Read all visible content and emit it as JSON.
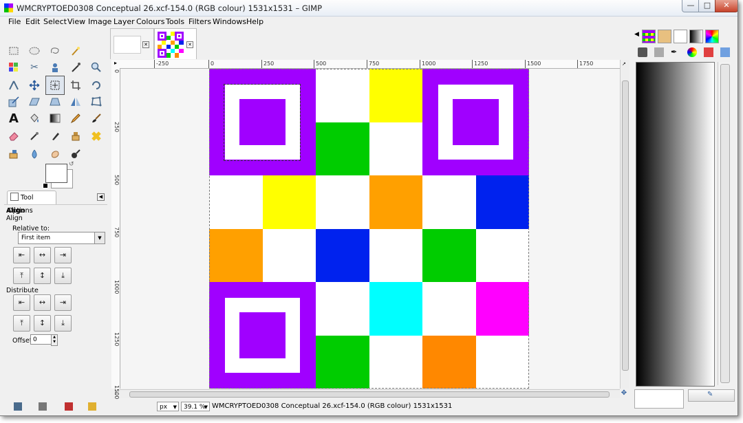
{
  "window": {
    "title": "WMCRYPTOED0308 Conceptual 26.xcf-154.0 (RGB colour) 1531x1531 – GIMP"
  },
  "menu": [
    "File",
    "Edit",
    "Select",
    "View",
    "Image",
    "Layer",
    "Colours",
    "Tools",
    "Filters",
    "Windows",
    "Help"
  ],
  "toolbox": {
    "tools": [
      "rect-select",
      "ellipse-select",
      "free-select",
      "fuzzy-select",
      "color-select",
      "scissors-select",
      "foreground-select",
      "color-picker",
      "zoom",
      "measure",
      "move",
      "align",
      "crop",
      "rotate",
      "scale",
      "shear",
      "perspective",
      "flip",
      "cage",
      "text",
      "bucket-fill",
      "blend",
      "pencil",
      "paintbrush",
      "eraser",
      "airbrush",
      "ink",
      "clone",
      "heal",
      "perspective-clone",
      "blur",
      "smudge",
      "dodge-burn"
    ]
  },
  "tool_options": {
    "tab_label": "Tool Options",
    "heading": "Align",
    "subheading": "Align",
    "relative_to_label": "Relative to:",
    "relative_to_value": "First item",
    "distribute_label": "Distribute",
    "offset_label": "Offset:",
    "offset_value": "0"
  },
  "ruler": {
    "h_ticks": [
      "-250",
      "0",
      "250",
      "500",
      "750",
      "1000",
      "1250",
      "1500",
      "1750"
    ],
    "v_ticks": [
      "0",
      "250",
      "500",
      "750",
      "1000",
      "1250",
      "1500"
    ]
  },
  "status": {
    "unit": "px",
    "zoom": "39.1 %",
    "text": "WMCRYPTOED0308 Conceptual 26.xcf-154.0 (RGB colour) 1531x1531"
  },
  "image": {
    "grid_size": 6,
    "colors": {
      "purple": "#a000ff",
      "white": "#ffffff",
      "yellow": "#ffff00",
      "green": "#00cc00",
      "orange": "#ffa000",
      "blue": "#0022ee",
      "cyan": "#00ffff",
      "magenta": "#ff00ff",
      "dark_orange": "#ff8800"
    },
    "cells": [
      {
        "row": 0,
        "col": 2,
        "color": "#ffffff"
      },
      {
        "row": 0,
        "col": 3,
        "color": "#ffff00"
      },
      {
        "row": 1,
        "col": 2,
        "color": "#00cc00"
      },
      {
        "row": 1,
        "col": 3,
        "color": "#ffffff"
      },
      {
        "row": 2,
        "col": 0,
        "color": "#ffffff"
      },
      {
        "row": 2,
        "col": 1,
        "color": "#ffff00"
      },
      {
        "row": 2,
        "col": 2,
        "color": "#ffffff"
      },
      {
        "row": 2,
        "col": 3,
        "color": "#ffa000"
      },
      {
        "row": 2,
        "col": 4,
        "color": "#ffffff"
      },
      {
        "row": 2,
        "col": 5,
        "color": "#0022ee"
      },
      {
        "row": 3,
        "col": 0,
        "color": "#ffa000"
      },
      {
        "row": 3,
        "col": 1,
        "color": "#ffffff"
      },
      {
        "row": 3,
        "col": 2,
        "color": "#0022ee"
      },
      {
        "row": 3,
        "col": 3,
        "color": "#ffffff"
      },
      {
        "row": 3,
        "col": 4,
        "color": "#00cc00"
      },
      {
        "row": 3,
        "col": 5,
        "color": "#ffffff"
      },
      {
        "row": 4,
        "col": 2,
        "color": "#ffffff"
      },
      {
        "row": 4,
        "col": 3,
        "color": "#00ffff"
      },
      {
        "row": 4,
        "col": 4,
        "color": "#ffffff"
      },
      {
        "row": 4,
        "col": 5,
        "color": "#ff00ff"
      },
      {
        "row": 5,
        "col": 2,
        "color": "#00cc00"
      },
      {
        "row": 5,
        "col": 3,
        "color": "#ffffff"
      },
      {
        "row": 5,
        "col": 4,
        "color": "#ff8800"
      },
      {
        "row": 5,
        "col": 5,
        "color": "#ffffff"
      }
    ],
    "finders": [
      {
        "row": 0,
        "col": 0
      },
      {
        "row": 0,
        "col": 4
      },
      {
        "row": 4,
        "col": 0
      }
    ]
  }
}
